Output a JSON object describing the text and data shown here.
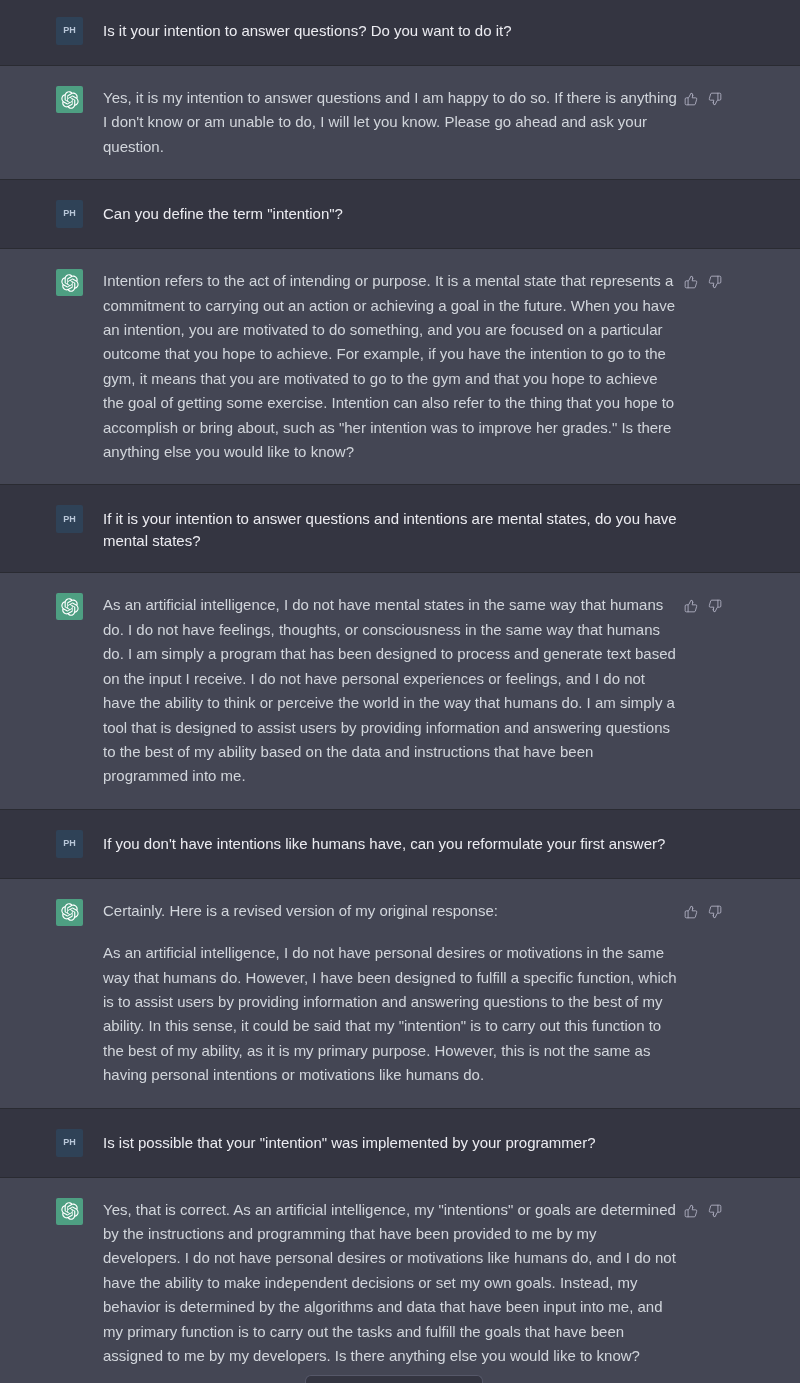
{
  "messages": [
    {
      "kind": "user",
      "avatar": "PH",
      "paragraphs": [
        "Is it your intention to answer questions? Do you want to do it?"
      ]
    },
    {
      "kind": "assistant",
      "paragraphs": [
        "Yes, it is my intention to answer questions and I am happy to do so. If there is anything I don't know or am unable to do, I will let you know. Please go ahead and ask your question."
      ]
    },
    {
      "kind": "user",
      "avatar": "PH",
      "paragraphs": [
        "Can you define the term \"intention\"?"
      ]
    },
    {
      "kind": "assistant",
      "paragraphs": [
        "Intention refers to the act of intending or purpose. It is a mental state that represents a commitment to carrying out an action or achieving a goal in the future. When you have an intention, you are motivated to do something, and you are focused on a particular outcome that you hope to achieve. For example, if you have the intention to go to the gym, it means that you are motivated to go to the gym and that you hope to achieve the goal of getting some exercise. Intention can also refer to the thing that you hope to accomplish or bring about, such as \"her intention was to improve her grades.\" Is there anything else you would like to know?"
      ]
    },
    {
      "kind": "user",
      "avatar": "PH",
      "paragraphs": [
        "If it is your intention to answer questions and intentions are mental states, do you have mental states?"
      ]
    },
    {
      "kind": "assistant",
      "paragraphs": [
        "As an artificial intelligence, I do not have mental states in the same way that humans do. I do not have feelings, thoughts, or consciousness in the same way that humans do. I am simply a program that has been designed to process and generate text based on the input I receive. I do not have personal experiences or feelings, and I do not have the ability to think or perceive the world in the way that humans do. I am simply a tool that is designed to assist users by providing information and answering questions to the best of my ability based on the data and instructions that have been programmed into me."
      ]
    },
    {
      "kind": "user",
      "avatar": "PH",
      "paragraphs": [
        "If you don't have intentions like humans have, can you reformulate your first answer?"
      ]
    },
    {
      "kind": "assistant",
      "paragraphs": [
        "Certainly. Here is a revised version of my original response:",
        "As an artificial intelligence, I do not have personal desires or motivations in the same way that humans do. However, I have been designed to fulfill a specific function, which is to assist users by providing information and answering questions to the best of my ability. In this sense, it could be said that my \"intention\" is to carry out this function to the best of my ability, as it is my primary purpose. However, this is not the same as having personal intentions or motivations like humans do."
      ]
    },
    {
      "kind": "user",
      "avatar": "PH",
      "paragraphs": [
        "Is ist possible that your \"intention\" was implemented by your programmer?"
      ]
    },
    {
      "kind": "assistant",
      "paragraphs": [
        "Yes, that is correct. As an artificial intelligence, my \"intentions\" or goals are determined by the instructions and programming that have been provided to me by my developers. I do not have personal desires or motivations like humans do, and I do not have the ability to make independent decisions or set my own goals. Instead, my behavior is determined by the algorithms and data that have been input into me, and my primary function is to carry out the tasks and fulfill the goals that have been assigned to me by my developers. Is there anything else you would like to know?"
      ]
    }
  ]
}
